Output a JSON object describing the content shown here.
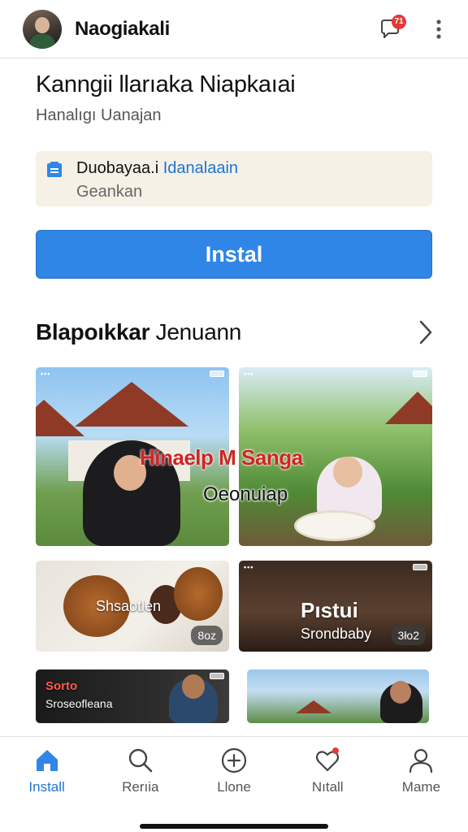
{
  "header": {
    "title": "Naogiakali",
    "notification_count": "71"
  },
  "app": {
    "name": "Kanngii llarıaka Niapkaıai",
    "developer": "Hanalıgı Uanajan"
  },
  "notice": {
    "line1_prefix": "Duobayaa.i",
    "line1_link": "Idanalaain",
    "line2": "Geankan"
  },
  "install_button": {
    "label": "Instal"
  },
  "section": {
    "title_bold": "Blapoıkkar",
    "title_light": "Jenuann"
  },
  "cards": [
    {
      "overlay_title": "Hinaelp M Sanga",
      "overlay_sub": "Oeonuiap"
    },
    {
      "label": "Shsaotlen",
      "duration": "8oz"
    },
    {
      "title": "Pıstui",
      "subtitle": "Srondbaby",
      "duration": "3ło2"
    },
    {
      "title": "Sorto",
      "subtitle": "Sroseofleana"
    }
  ],
  "bottom_nav": [
    {
      "label": "Install",
      "icon": "home-icon",
      "active": true
    },
    {
      "label": "Rerıia",
      "icon": "search-icon",
      "active": false
    },
    {
      "label": "Llone",
      "icon": "plus-circle-icon",
      "active": false
    },
    {
      "label": "Nıtall",
      "icon": "heart-chat-icon",
      "active": false
    },
    {
      "label": "Mame",
      "icon": "person-icon",
      "active": false
    }
  ],
  "colors": {
    "accent": "#2f86e6",
    "link": "#1e74d6",
    "badge": "#e53935",
    "notice_bg": "#f5f1e7",
    "overlay_title": "#d22323"
  }
}
